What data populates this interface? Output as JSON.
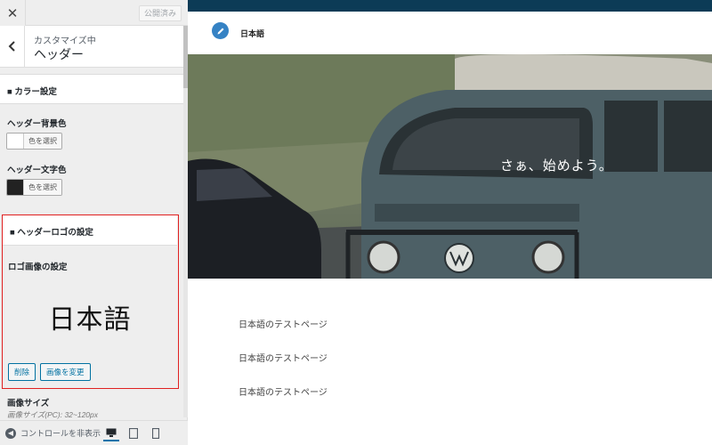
{
  "sidebar": {
    "close_icon": "close-icon",
    "publish_label": "公開済み",
    "breadcrumb": "カスタマイズ中",
    "section_title": "ヘッダー",
    "color_group_title": "■ カラー設定",
    "header_bg_label": "ヘッダー背景色",
    "header_bg_button": "色を選択",
    "header_bg_color": "#ffffff",
    "header_text_label": "ヘッダー文字色",
    "header_text_button": "色を選択",
    "header_text_color": "#222222",
    "logo_group_title": "■ ヘッダーロゴの設定",
    "logo_image_label": "ロゴ画像の設定",
    "logo_preview_text": "日本語",
    "remove_button": "削除",
    "change_image_button": "画像を変更",
    "image_size_label": "画像サイズ",
    "image_size_hint": "画像サイズ(PC): 32~120px",
    "hide_controls_label": "コントロールを非表示",
    "devices": [
      "desktop-icon",
      "tablet-icon",
      "mobile-icon"
    ]
  },
  "preview": {
    "accent_color": "#0c3b56",
    "site_title": "日本語",
    "hero_text": "さぁ、始めよう。",
    "page_links": [
      "日本語のテストページ",
      "日本語のテストページ",
      "日本語のテストページ"
    ]
  }
}
